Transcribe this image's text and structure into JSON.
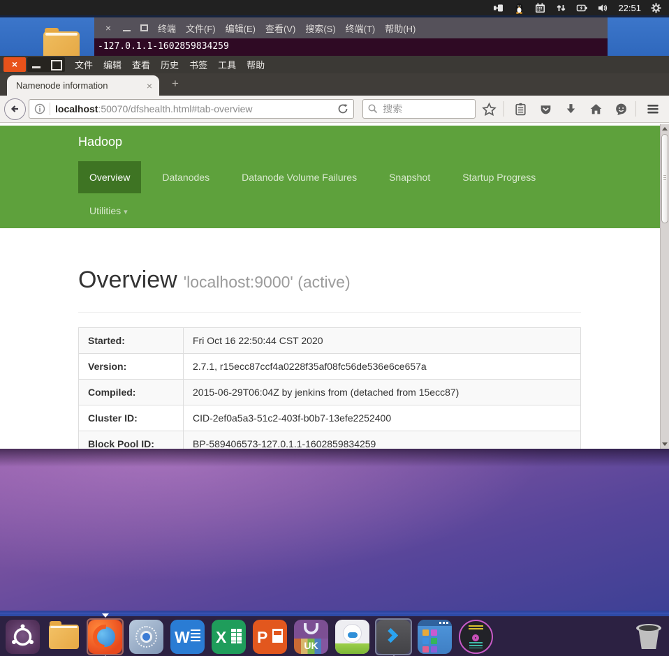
{
  "colors": {
    "hadoop_green": "#5ea13c",
    "hadoop_green_active": "#3e7423",
    "ubuntu_orange": "#e8521a",
    "terminal_bg": "#2f0a24",
    "desktop_purple": "#74509f",
    "dock_bg": "#2c2142",
    "blue_window": "#2f68bd"
  },
  "system_bar": {
    "clock": "22:51",
    "icons": [
      "input-method-icon",
      "linux-tux-icon",
      "calendar-icon",
      "network-arrows-icon",
      "battery-icon",
      "volume-icon",
      "session-gear-icon"
    ]
  },
  "terminal": {
    "window_title": "终端",
    "controls": {
      "close": "×"
    },
    "menus": [
      "文件(F)",
      "编辑(E)",
      "查看(V)",
      "搜索(S)",
      "终端(T)",
      "帮助(H)"
    ],
    "output_line": "-127.0.1.1-1602859834259"
  },
  "browser": {
    "window_controls": {
      "close": "×"
    },
    "menus": [
      "文件",
      "编辑",
      "查看",
      "历史",
      "书签",
      "工具",
      "帮助"
    ],
    "tab": {
      "title": "Namenode information",
      "close_glyph": "×",
      "new_tab_glyph": "+"
    },
    "address": {
      "host": "localhost",
      "path": ":50070/dfshealth.html#tab-overview"
    },
    "search": {
      "placeholder": "搜索"
    },
    "toolbar_icons": [
      "back-icon",
      "page-info-icon",
      "reload-icon",
      "search-icon",
      "bookmark-star-icon",
      "reading-list-icon",
      "pocket-icon",
      "downloads-icon",
      "home-icon",
      "hello-chat-icon",
      "menu-hamburger-icon"
    ]
  },
  "page": {
    "brand": "Hadoop",
    "nav": [
      {
        "label": "Overview",
        "active": true
      },
      {
        "label": "Datanodes",
        "active": false
      },
      {
        "label": "Datanode Volume Failures",
        "active": false
      },
      {
        "label": "Snapshot",
        "active": false
      },
      {
        "label": "Startup Progress",
        "active": false
      }
    ],
    "utilities": {
      "label": "Utilities",
      "caret": "▾"
    },
    "heading": "Overview",
    "subheading": "'localhost:9000' (active)",
    "info_table": {
      "rows": [
        {
          "label": "Started:",
          "value": "Fri Oct 16 22:50:44 CST 2020"
        },
        {
          "label": "Version:",
          "value": "2.7.1, r15ecc87ccf4a0228f35af08fc56de536e6ce657a"
        },
        {
          "label": "Compiled:",
          "value": "2015-06-29T06:04Z by jenkins from (detached from 15ecc87)"
        },
        {
          "label": "Cluster ID:",
          "value": "CID-2ef0a5a3-51c2-403f-b0b7-13efe2252400"
        },
        {
          "label": "Block Pool ID:",
          "value": "BP-589406573-127.0.1.1-1602859834259"
        }
      ]
    }
  },
  "dock": {
    "items": [
      "dash-launcher",
      "file-manager",
      "firefox",
      "chromium-settings",
      "word",
      "excel",
      "powerpoint",
      "software-center",
      "assistant-app",
      "terminal-launcher",
      "workspace-tiles",
      "media-disc"
    ],
    "trash": "trash"
  }
}
